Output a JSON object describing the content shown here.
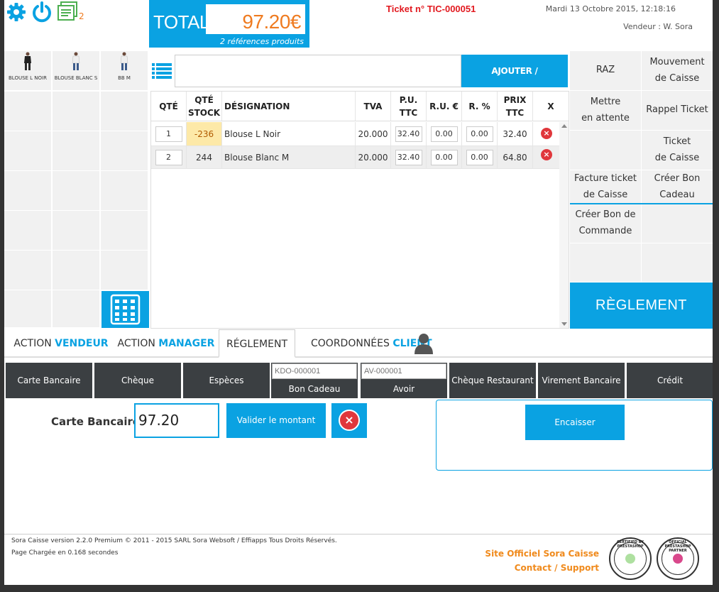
{
  "header": {
    "total_label": "TOTAL",
    "total_value": "97.20€",
    "references": "2 références produits",
    "ticket": "Ticket n° TIC-000051",
    "date": "Mardi 13 Octobre 2015, 12:18:16",
    "vendeur": "Vendeur : W. Sora",
    "notif_count": "2"
  },
  "products": [
    {
      "label": "BLOUSE L NOIR"
    },
    {
      "label": "BLOUSE BLANC S"
    },
    {
      "label": "BB M"
    }
  ],
  "search": {
    "value": "",
    "add_label": "AJOUTER / RECHERCHER"
  },
  "cart": {
    "headers": {
      "qte": "QTÉ",
      "stock": "QTÉ STOCK",
      "designation": "DÉSIGNATION",
      "tva": "TVA",
      "pu": "P.U. TTC",
      "ru": "R.U. €",
      "rp": "R. %",
      "prix": "PRIX TTC",
      "x": "X"
    },
    "rows": [
      {
        "qte": "1",
        "stock": "-236",
        "designation": "Blouse L Noir",
        "tva": "20.000",
        "pu": "32.40",
        "ru": "0.00",
        "rp": "0.00",
        "prix": "32.40"
      },
      {
        "qte": "2",
        "stock": "244",
        "designation": "Blouse Blanc M",
        "tva": "20.000",
        "pu": "32.40",
        "ru": "0.00",
        "rp": "0.00",
        "prix": "64.80"
      }
    ]
  },
  "actions": {
    "raz": "RAZ",
    "mouvement": "Mouvement\nde Caisse",
    "attente": "Mettre\nen attente",
    "rappel": "Rappel Ticket",
    "ticket_caisse": "Ticket\nde Caisse",
    "facture": "Facture ticket\nde Caisse",
    "bon_cadeau": "Créer Bon\nCadeau",
    "bon_commande": "Créer Bon de\nCommande",
    "reglement": "RÈGLEMENT"
  },
  "tabs": [
    {
      "prefix": "ACTION ",
      "highlight": "VENDEUR"
    },
    {
      "prefix": "ACTION ",
      "highlight": "MANAGER"
    },
    {
      "prefix": "RÉGLEMENT",
      "highlight": ""
    },
    {
      "prefix": "COORDONNÉES ",
      "highlight": "CLIENT"
    }
  ],
  "payment": {
    "carte": "Carte Bancaire",
    "cheque": "Chèque",
    "especes": "Espèces",
    "bon_cadeau_placeholder": "KDO-000001",
    "bon_cadeau": "Bon Cadeau",
    "avoir_placeholder": "AV-000001",
    "avoir": "Avoir",
    "cheque_resto": "Chèque Restaurant",
    "virement": "Virement Bancaire",
    "credit": "Crédit"
  },
  "amount": {
    "label": "Carte Bancaire :",
    "value": "97.20",
    "valider": "Valider le montant",
    "encaisser": "Encaisser"
  },
  "footer": {
    "line1": "Sora Caisse version 2.2.0 Premium © 2011 - 2015 SARL Sora Websoft / Effiapps Tous Droits Réservés.",
    "line2": "Page Chargée en 0.168 secondes",
    "site": "Site Officiel Sora Caisse",
    "contact": "Contact / Support",
    "badge1": "CERTIFIED BY PRESTASHOP",
    "badge2": "OFFICIAL PRESTASHOP PARTNER"
  },
  "colors": {
    "accent": "#0aa2e2",
    "total_value": "#ef7b20",
    "ticket": "#e2191f",
    "dark_button": "#3b3f42",
    "link": "#f08a1c"
  }
}
